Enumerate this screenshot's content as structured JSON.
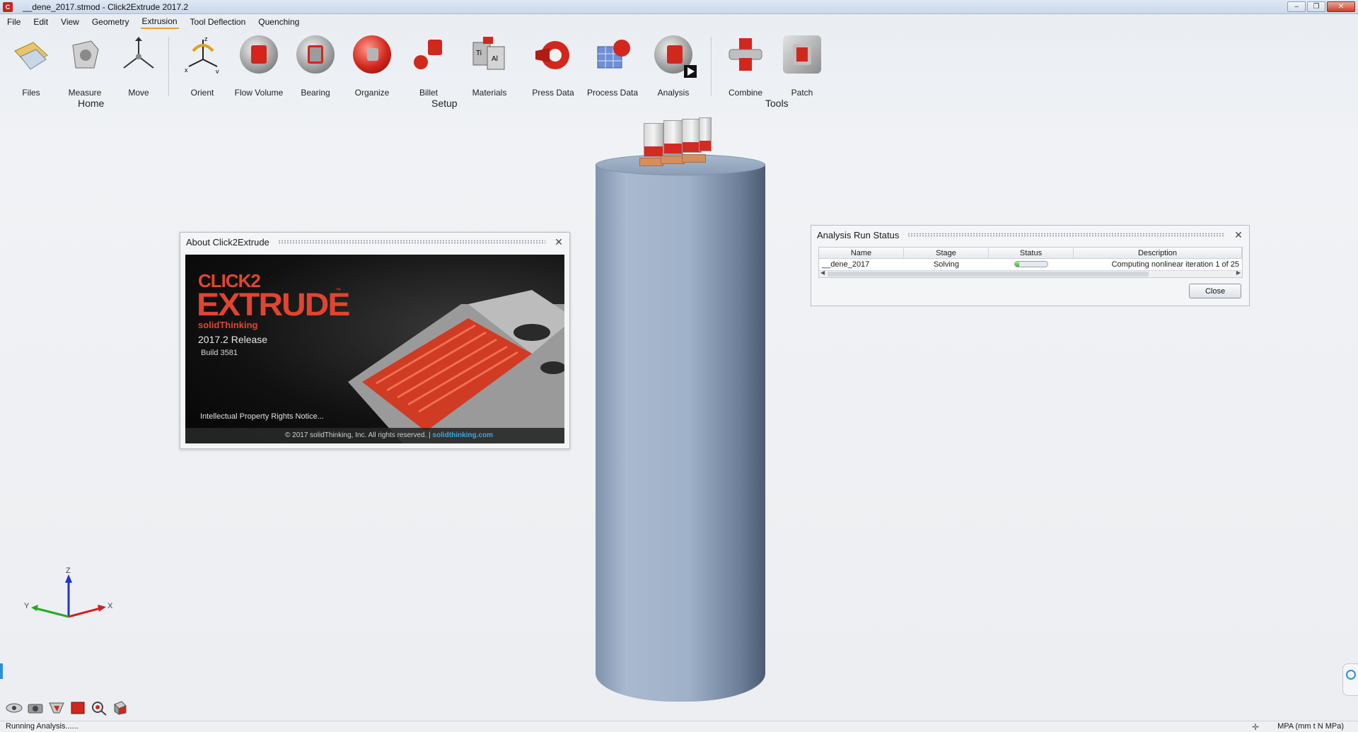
{
  "window": {
    "title": "__dene_2017.stmod - Click2Extrude 2017.2",
    "controls": [
      "–",
      "❐",
      "✕"
    ]
  },
  "menu": [
    "File",
    "Edit",
    "View",
    "Geometry",
    "Extrusion",
    "Tool Deflection",
    "Quenching"
  ],
  "menu_active": "Extrusion",
  "ribbon": {
    "home": {
      "label": "Home",
      "buttons": [
        "Files",
        "Measure",
        "Move"
      ]
    },
    "setup": {
      "label": "Setup",
      "buttons": [
        "Orient",
        "Flow Volume",
        "Bearing",
        "Organize",
        "Billet",
        "Materials",
        "Press Data",
        "Process Data",
        "Analysis"
      ]
    },
    "tools": {
      "label": "Tools",
      "buttons": [
        "Combine",
        "Patch"
      ]
    },
    "axis_letters": {
      "x": "x",
      "y": "y",
      "z": "z"
    },
    "material_letters": {
      "ti": "Ti",
      "al": "Al"
    }
  },
  "about": {
    "title": "About Click2Extrude",
    "brand_line1": "CLICK2",
    "brand_line2": "EXTRUDE",
    "tm": "™",
    "vendor": "solidThinking",
    "release": "2017.2 Release",
    "build": "Build 3581",
    "notice": "Intellectual Property Rights Notice...",
    "copyright": "© 2017 solidThinking, Inc. All rights reserved.  |",
    "link": "solidthinking.com"
  },
  "analysis": {
    "title": "Analysis Run Status",
    "columns": [
      "Name",
      "Stage",
      "Status",
      "Description"
    ],
    "rows": [
      {
        "name": "__dene_2017",
        "stage": "Solving",
        "progress": 0.12,
        "description": "Computing nonlinear iteration 1 of 25"
      }
    ],
    "close_label": "Close"
  },
  "triad": {
    "z": "Z",
    "y": "Y",
    "x": "X"
  },
  "status": {
    "left": "Running Analysis......",
    "units": "MPA (mm t N MPa)"
  },
  "colors": {
    "accent_red": "#d2271d",
    "billet_blue": "#9fb1c8",
    "link_blue": "#36a9e6",
    "progress_green": "#3bb42a"
  }
}
